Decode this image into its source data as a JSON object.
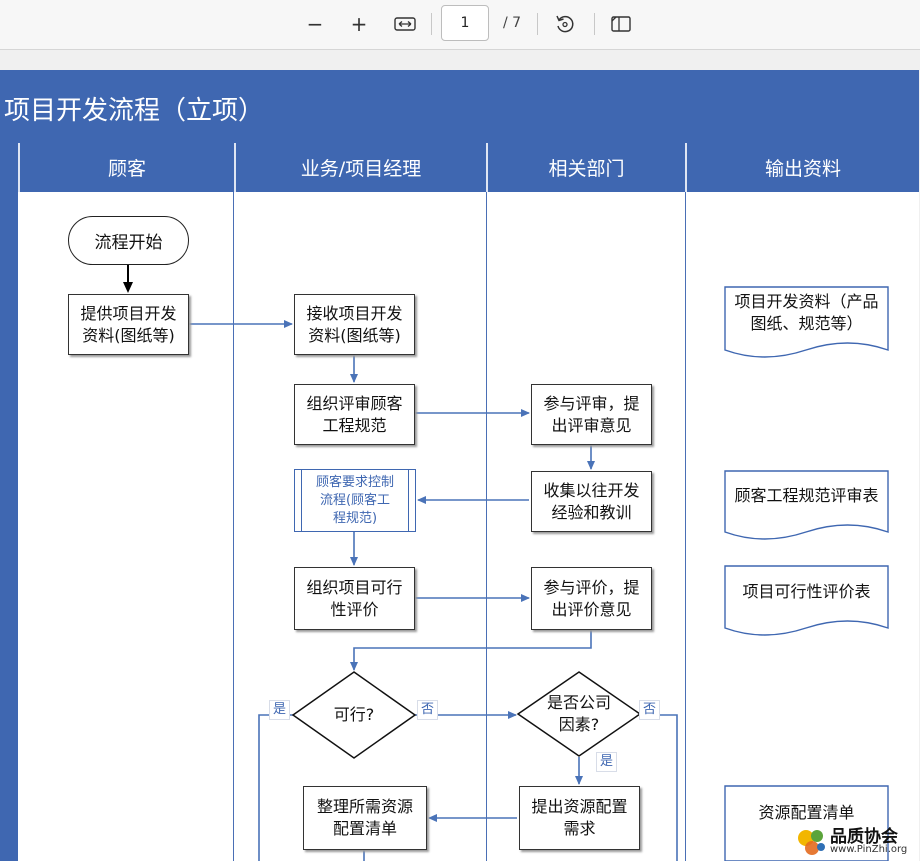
{
  "toolbar": {
    "zoom_out": "−",
    "zoom_in": "+",
    "page_number": "1",
    "page_total": "/ 7"
  },
  "title": "项目开发流程（立项）",
  "lanes": [
    "顾客",
    "业务/项目经理",
    "相关部门",
    "输出资料"
  ],
  "nodes": {
    "start": "流程开始",
    "provide": "提供项目开发\n资料(图纸等)",
    "receive": "接收项目开发\n资料(图纸等)",
    "review_org": "组织评审顾客\n工程规范",
    "review_join": "参与评审，提\n出评审意见",
    "control_flow": "顾客要求控制\n流程(顾客工\n程规范)",
    "collect": "收集以往开发\n经验和教训",
    "feasibility_org": "组织项目可行\n性评价",
    "feasibility_join": "参与评价，提\n出评价意见",
    "feasible_q": "可行?",
    "company_q": "是否公司\n因素?",
    "resource_list": "整理所需资源\n配置清单",
    "resource_req": "提出资源配置\n需求"
  },
  "labels": {
    "yes": "是",
    "no": "否"
  },
  "outputs": {
    "doc1": "项目开发资料（产品\n图纸、规范等）",
    "doc2": "顾客工程规范评审表",
    "doc3": "项目可行性评价表",
    "doc4": "资源配置清单"
  },
  "watermark": {
    "name": "品质协会",
    "url": "www.PinZhi.org"
  },
  "colors": {
    "header_blue": "#3f67b1",
    "connector_blue": "#4a73b8"
  }
}
